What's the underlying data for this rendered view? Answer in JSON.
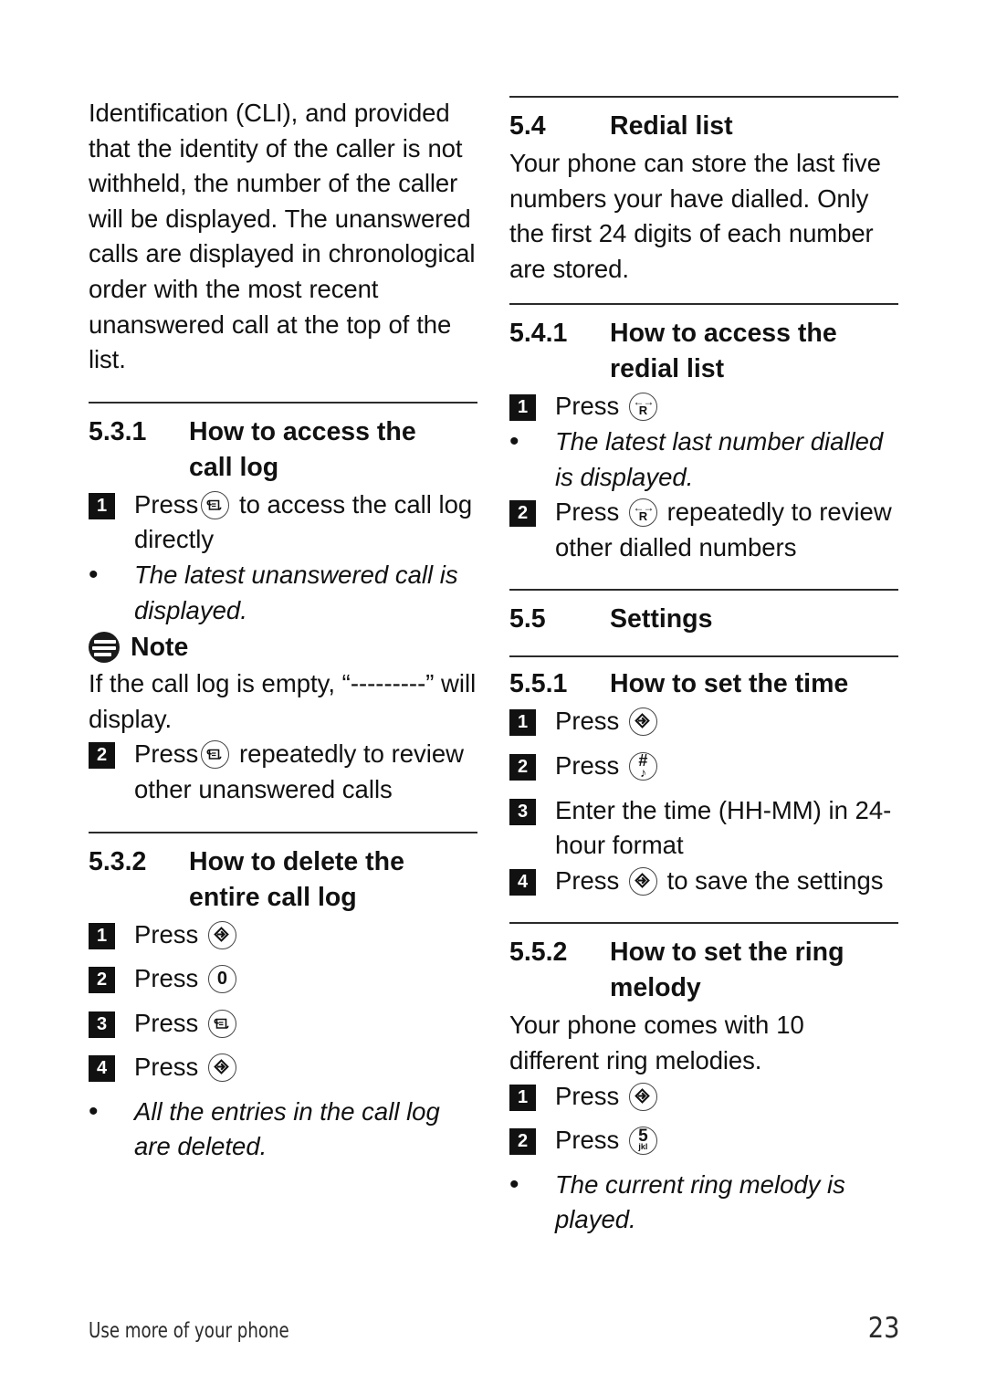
{
  "document": {
    "footer_left": "Use more of your phone",
    "page_number": "23"
  },
  "icons": {
    "call_log_key": "call-log-key-icon",
    "menu_key": "menu-ok-key-icon",
    "redial_key": "redial-r-key-icon",
    "zero_key": "key-0-icon",
    "hash_key": "key-hash-icon",
    "five_key": "key-5-jkl-icon",
    "note": "note-icon",
    "zero_label": "0",
    "five_label": "5",
    "five_sub": "jkl",
    "hash_label": "#",
    "hash_sub": "♪",
    "redial_letter": "R",
    "redial_arrows": "←→"
  },
  "left_column": {
    "intro_paragraph": "Identification (CLI), and provided that the identity of the caller is not withheld, the number of the caller will be displayed. The unanswered calls are displayed in chronological order with the most recent unanswered call at the top of the list.",
    "section_531": {
      "number": "5.3.1",
      "title_line1": "How to access the",
      "title_line2": "call log",
      "step1_badge": "1",
      "step1_before": "Press",
      "step1_after": "to access the call log directly",
      "bullet_dot": "•",
      "bullet1": "The latest unanswered call is displayed.",
      "note_title": "Note",
      "note_body": "If the call log is empty, “---------” will display.",
      "step2_badge": "2",
      "step2_before": "Press",
      "step2_after": "repeatedly to review other unanswered calls"
    },
    "section_532": {
      "number": "5.3.2",
      "title_line1": "How to delete the",
      "title_line2": "entire call log",
      "steps": [
        {
          "badge": "1",
          "label": "Press",
          "key": "menu"
        },
        {
          "badge": "2",
          "label": "Press",
          "key": "zero"
        },
        {
          "badge": "3",
          "label": "Press",
          "key": "calllog"
        },
        {
          "badge": "4",
          "label": "Press",
          "key": "menu"
        }
      ],
      "bullet_dot": "•",
      "bullet1": "All the entries in the call log are deleted."
    }
  },
  "right_column": {
    "section_54": {
      "number": "5.4",
      "title": "Redial list",
      "body": "Your phone can store the last five numbers your have dialled. Only the first 24 digits of each number are stored."
    },
    "section_541": {
      "number": "5.4.1",
      "title_line1": "How to access the",
      "title_line2": "redial list",
      "step1_badge": "1",
      "step1_before": "Press",
      "bullet_dot": "•",
      "bullet1": "The latest last number dialled is displayed.",
      "step2_badge": "2",
      "step2_before": "Press",
      "step2_after": "repeatedly to review other dialled numbers"
    },
    "section_55": {
      "number": "5.5",
      "title": "Settings"
    },
    "section_551": {
      "number": "5.5.1",
      "title": "How to set the time",
      "step1_badge": "1",
      "step1_before": "Press",
      "step2_badge": "2",
      "step2_before": "Press",
      "step3_badge": "3",
      "step3_text": "Enter the time (HH-MM) in 24-hour format",
      "step4_badge": "4",
      "step4_before": "Press",
      "step4_after": "to save the settings"
    },
    "section_552": {
      "number": "5.5.2",
      "title_line1": "How to set the ring",
      "title_line2": "melody",
      "body": "Your phone comes with 10 different ring melodies.",
      "step1_badge": "1",
      "step1_before": "Press",
      "step2_badge": "2",
      "step2_before": "Press",
      "bullet_dot": "•",
      "bullet1": "The current ring melody is played."
    }
  }
}
